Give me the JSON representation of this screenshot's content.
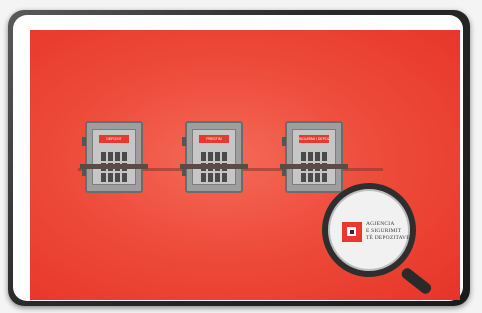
{
  "safes": [
    {
      "label": "DEPOSIT",
      "color": "#e53a2c"
    },
    {
      "label": "PRESTIM",
      "color": "#e53a2c"
    },
    {
      "label": "SIGURIMI I DEPOZITAVE",
      "color": "#e53a2c"
    }
  ],
  "logo": {
    "line1": "AGJENCIA",
    "line2": "E SIGURIMIT",
    "line3": "TË DEPOZITAVE"
  },
  "colors": {
    "panel_red": "#ee4c3c",
    "safe_gray": "#9e9e9e",
    "logo_red": "#e8392b"
  },
  "icons": [
    "safe-icon",
    "magnifying-glass-icon"
  ]
}
